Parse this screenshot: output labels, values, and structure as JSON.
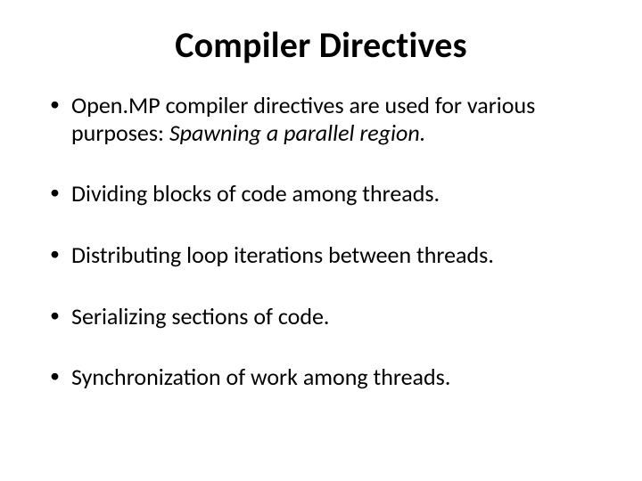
{
  "title": "Compiler Directives",
  "bullets": [
    {
      "pre": "Open.MP compiler directives are used for various purposes:  ",
      "em": "Spawning a parallel region.",
      "post": ""
    },
    {
      "pre": "Dividing blocks of code among threads.",
      "em": "",
      "post": ""
    },
    {
      "pre": "Distributing loop iterations between threads.",
      "em": "",
      "post": ""
    },
    {
      "pre": "Serializing sections of code.",
      "em": "",
      "post": ""
    },
    {
      "pre": "Synchronization of work among threads.",
      "em": "",
      "post": ""
    }
  ]
}
